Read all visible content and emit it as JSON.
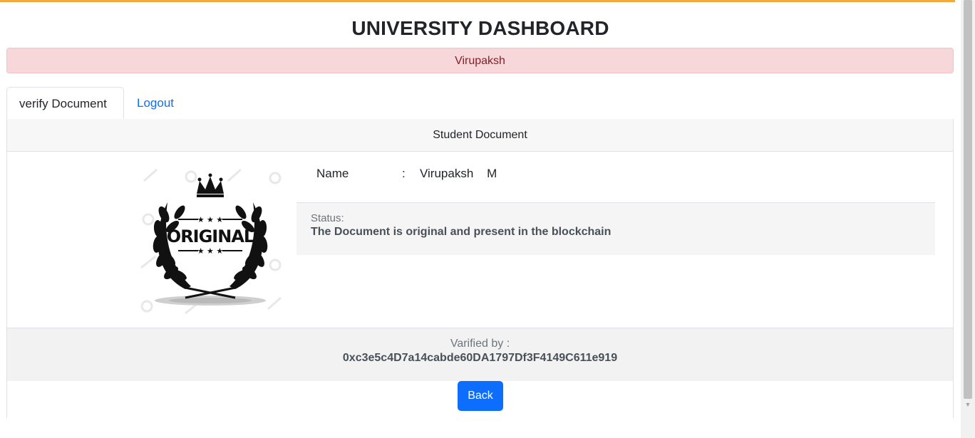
{
  "page": {
    "title": "UNIVERSITY DASHBOARD"
  },
  "alert": {
    "username": "Virupaksh"
  },
  "tabs": [
    {
      "label": "verify Document",
      "active": true
    },
    {
      "label": "Logout",
      "active": false
    }
  ],
  "card": {
    "header": "Student Document",
    "image_alt": "original-stamp",
    "stamp_text": "ORIGINAL",
    "name_label": "Name",
    "name_separator": ":",
    "name_value": "Virupaksh    M",
    "status_label": "Status:",
    "status_text": "The Document is original and present in the blockchain",
    "verified_label": "Varified by :",
    "verified_address": "0xc3e5c4D7a14cabde60DA1797Df3F4149C611e919"
  },
  "actions": {
    "back_label": "Back"
  },
  "colors": {
    "top_stripe": "#f2a93b",
    "alert_bg": "#f8d7da",
    "alert_text": "#842029",
    "link": "#0d6efd",
    "primary_button": "#0d6efd"
  }
}
